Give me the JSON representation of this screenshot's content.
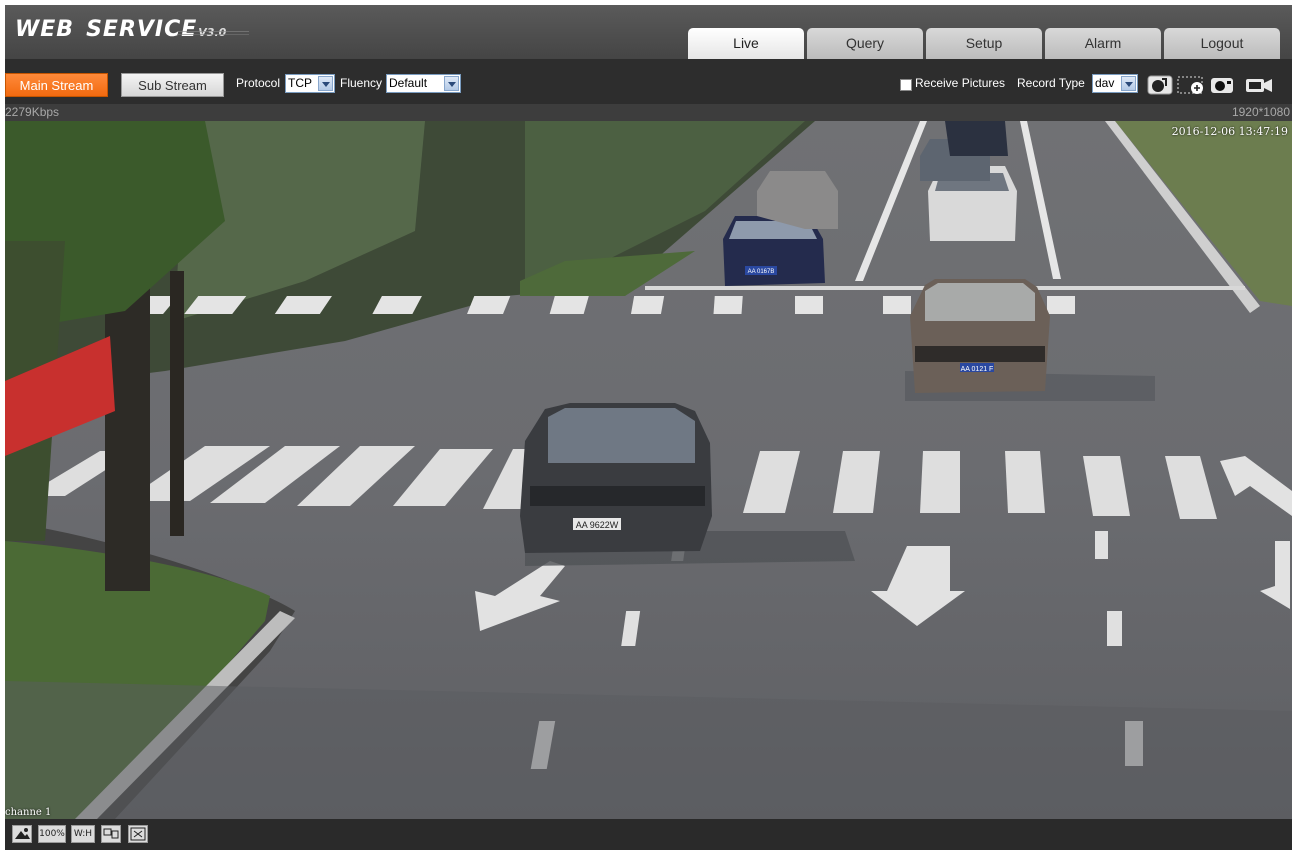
{
  "header": {
    "logo_main": "WEB",
    "logo_service": "SERVICE",
    "logo_version": "V3.0",
    "tabs": [
      {
        "label": "Live",
        "active": true
      },
      {
        "label": "Query",
        "active": false
      },
      {
        "label": "Setup",
        "active": false
      },
      {
        "label": "Alarm",
        "active": false
      },
      {
        "label": "Logout",
        "active": false
      }
    ]
  },
  "toolbar": {
    "main_stream": "Main Stream",
    "sub_stream": "Sub Stream",
    "protocol_label": "Protocol",
    "protocol_value": "TCP",
    "fluency_label": "Fluency",
    "fluency_value": "Default",
    "receive_pictures_label": "Receive Pictures",
    "receive_pictures_checked": false,
    "record_type_label": "Record Type",
    "record_type_value": "dav",
    "icons": [
      "manual-record-icon",
      "digital-zoom-icon",
      "snapshot-icon",
      "record-icon"
    ]
  },
  "infobar": {
    "bitrate": "2279Kbps",
    "resolution": "1920*1080"
  },
  "video": {
    "osd_timestamp": "2016-12-06 13:47:19",
    "channel_label": "channe 1",
    "plates": [
      "AA 9622W",
      "AA 0121 F",
      "AA 0167B"
    ]
  },
  "bottombar": {
    "zoom_label": "100%",
    "wh_label": "W:H",
    "icons": [
      "snapshot-view-icon",
      "original-size-icon",
      "aspect-ratio-icon",
      "window-mode-icon",
      "fullscreen-icon"
    ]
  },
  "colors": {
    "accent": "#f26a10",
    "tab_bg": "#d0d0d0",
    "header_bg": "#4f4f4f",
    "toolbar_bg": "#2d2d2d"
  }
}
